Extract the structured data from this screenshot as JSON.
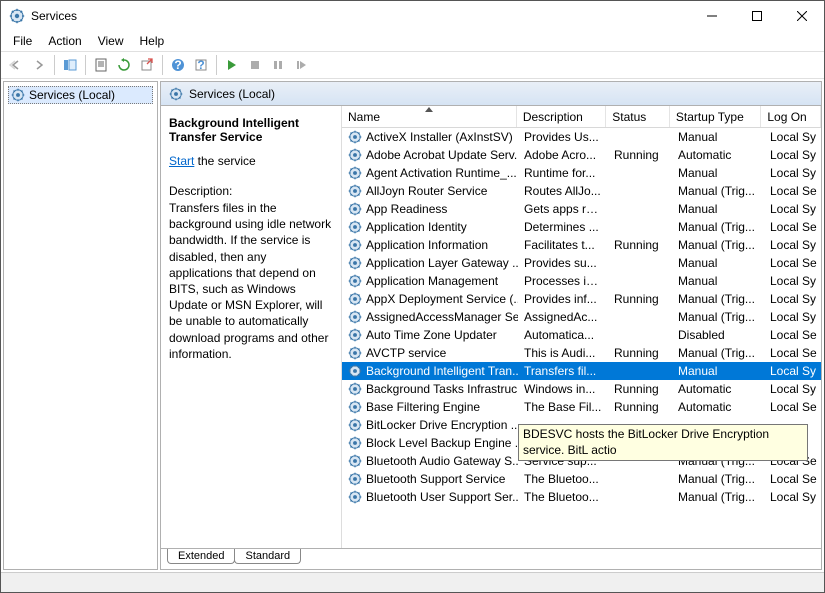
{
  "window": {
    "title": "Services"
  },
  "menu": {
    "file": "File",
    "action": "Action",
    "view": "View",
    "help": "Help"
  },
  "left": {
    "root": "Services (Local)"
  },
  "header": {
    "title": "Services (Local)"
  },
  "detail": {
    "selected_name": "Background Intelligent Transfer Service",
    "start_link": "Start",
    "start_suffix": " the service",
    "desc_label": "Description:",
    "desc_text": "Transfers files in the background using idle network bandwidth. If the service is disabled, then any applications that depend on BITS, such as Windows Update or MSN Explorer, will be unable to automatically download programs and other information."
  },
  "columns": {
    "name": "Name",
    "description": "Description",
    "status": "Status",
    "startup": "Startup Type",
    "logon": "Log On"
  },
  "services": [
    {
      "name": "ActiveX Installer (AxInstSV)",
      "desc": "Provides Us...",
      "status": "",
      "startup": "Manual",
      "logon": "Local Sy"
    },
    {
      "name": "Adobe Acrobat Update Serv...",
      "desc": "Adobe Acro...",
      "status": "Running",
      "startup": "Automatic",
      "logon": "Local Sy"
    },
    {
      "name": "Agent Activation Runtime_...",
      "desc": "Runtime for...",
      "status": "",
      "startup": "Manual",
      "logon": "Local Sy"
    },
    {
      "name": "AllJoyn Router Service",
      "desc": "Routes AllJo...",
      "status": "",
      "startup": "Manual (Trig...",
      "logon": "Local Se"
    },
    {
      "name": "App Readiness",
      "desc": "Gets apps re...",
      "status": "",
      "startup": "Manual",
      "logon": "Local Sy"
    },
    {
      "name": "Application Identity",
      "desc": "Determines ...",
      "status": "",
      "startup": "Manual (Trig...",
      "logon": "Local Se"
    },
    {
      "name": "Application Information",
      "desc": "Facilitates t...",
      "status": "Running",
      "startup": "Manual (Trig...",
      "logon": "Local Sy"
    },
    {
      "name": "Application Layer Gateway ...",
      "desc": "Provides su...",
      "status": "",
      "startup": "Manual",
      "logon": "Local Se"
    },
    {
      "name": "Application Management",
      "desc": "Processes in...",
      "status": "",
      "startup": "Manual",
      "logon": "Local Sy"
    },
    {
      "name": "AppX Deployment Service (...",
      "desc": "Provides inf...",
      "status": "Running",
      "startup": "Manual (Trig...",
      "logon": "Local Sy"
    },
    {
      "name": "AssignedAccessManager Se...",
      "desc": "AssignedAc...",
      "status": "",
      "startup": "Manual (Trig...",
      "logon": "Local Sy"
    },
    {
      "name": "Auto Time Zone Updater",
      "desc": "Automatica...",
      "status": "",
      "startup": "Disabled",
      "logon": "Local Se"
    },
    {
      "name": "AVCTP service",
      "desc": "This is Audi...",
      "status": "Running",
      "startup": "Manual (Trig...",
      "logon": "Local Se"
    },
    {
      "name": "Background Intelligent Tran...",
      "desc": "Transfers fil...",
      "status": "",
      "startup": "Manual",
      "logon": "Local Sy",
      "selected": true
    },
    {
      "name": "Background Tasks Infrastruc...",
      "desc": "Windows in...",
      "status": "Running",
      "startup": "Automatic",
      "logon": "Local Sy"
    },
    {
      "name": "Base Filtering Engine",
      "desc": "The Base Fil...",
      "status": "Running",
      "startup": "Automatic",
      "logon": "Local Se"
    },
    {
      "name": "BitLocker Drive Encryption ...",
      "desc": "",
      "status": "",
      "startup": "",
      "logon": ""
    },
    {
      "name": "Block Level Backup Engine ...",
      "desc": "",
      "status": "",
      "startup": "",
      "logon": ""
    },
    {
      "name": "Bluetooth Audio Gateway S...",
      "desc": "Service sup...",
      "status": "",
      "startup": "Manual (Trig...",
      "logon": "Local Se"
    },
    {
      "name": "Bluetooth Support Service",
      "desc": "The Bluetoo...",
      "status": "",
      "startup": "Manual (Trig...",
      "logon": "Local Se"
    },
    {
      "name": "Bluetooth User Support Ser...",
      "desc": "The Bluetoo...",
      "status": "",
      "startup": "Manual (Trig...",
      "logon": "Local Sy"
    }
  ],
  "tooltip": {
    "text": "BDESVC hosts the BitLocker Drive Encryption service. BitL actio"
  },
  "tabs": {
    "extended": "Extended",
    "standard": "Standard"
  }
}
